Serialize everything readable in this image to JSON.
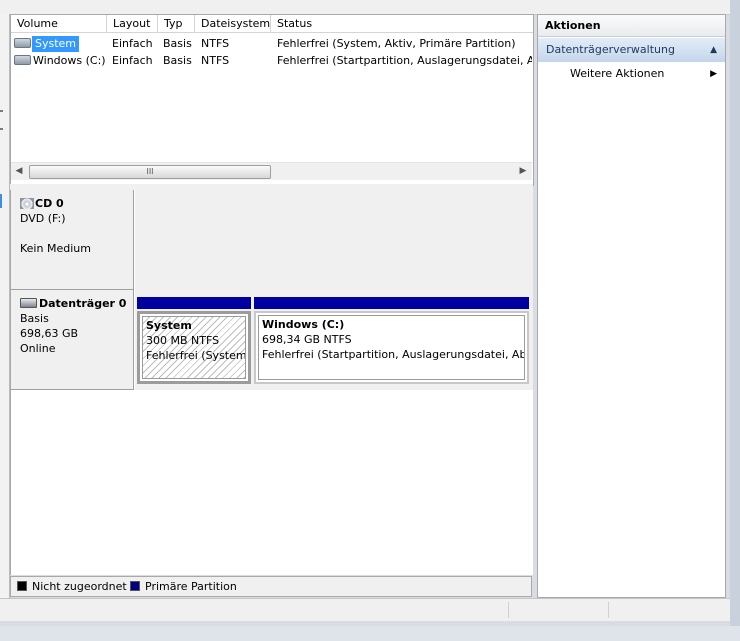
{
  "volume_list": {
    "columns": [
      "Volume",
      "Layout",
      "Typ",
      "Dateisystem",
      "Status"
    ],
    "rows": [
      {
        "name": "System",
        "layout": "Einfach",
        "type": "Basis",
        "fs": "NTFS",
        "status": "Fehlerfrei (System, Aktiv, Primäre Partition)",
        "selected": true
      },
      {
        "name": "Windows (C:)",
        "layout": "Einfach",
        "type": "Basis",
        "fs": "NTFS",
        "status": "Fehlerfrei (Startpartition, Auslagerungsdatei, Abs",
        "selected": false
      }
    ],
    "scroll_thumb_glyph": "III"
  },
  "disks": [
    {
      "title": "CD 0",
      "line1": "DVD (F:)",
      "line2": "",
      "line3": "Kein Medium",
      "icon": "cd-drive-icon"
    },
    {
      "title": "Datenträger 0",
      "line1": "Basis",
      "line2": "698,63 GB",
      "line3": "Online",
      "icon": "hard-disk-icon"
    }
  ],
  "partitions": [
    {
      "name": "System",
      "size": "300 MB NTFS",
      "status": "Fehlerfrei (System,"
    },
    {
      "name": "Windows  (C:)",
      "size": "698,34 GB NTFS",
      "status": "Fehlerfrei (Startpartition, Auslagerungsdatei, Absti"
    }
  ],
  "legend": [
    {
      "label": "Nicht zugeordnet",
      "color": "#000000"
    },
    {
      "label": "Primäre Partition",
      "color": "#000080"
    }
  ],
  "actions": {
    "header": "Aktionen",
    "section": "Datenträgerverwaltung",
    "item": "Weitere Aktionen"
  },
  "colors": {
    "selection": "#3399ff",
    "primary_partition_bar": "#0000a0",
    "actions_section": "#c4d6ec"
  }
}
